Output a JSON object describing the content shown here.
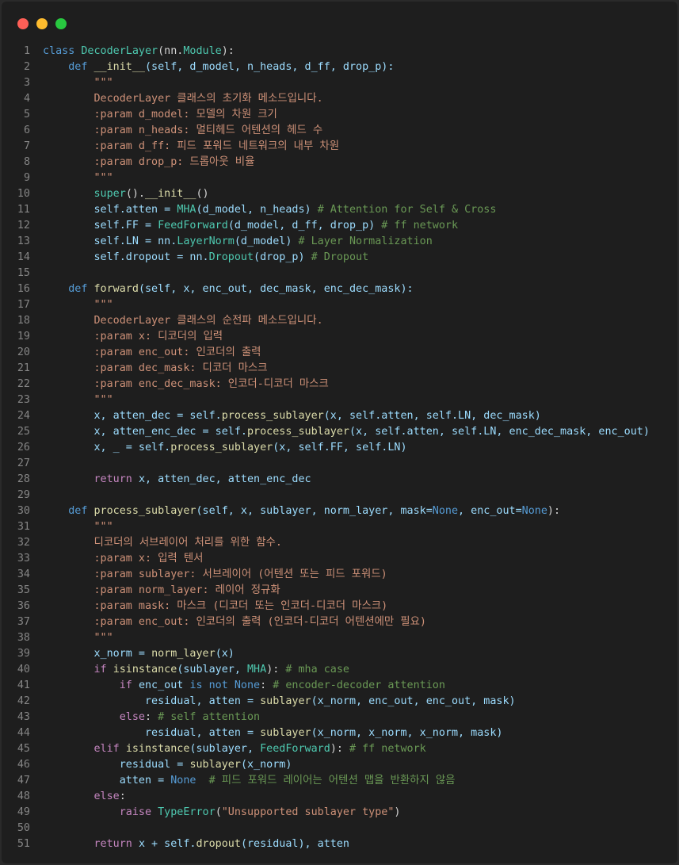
{
  "window": {
    "buttons": [
      "close",
      "minimize",
      "maximize"
    ],
    "colors": {
      "close": "#ff5f57",
      "minimize": "#febc2e",
      "maximize": "#28c840",
      "background": "#1e1e1e"
    }
  },
  "code": {
    "language": "python",
    "lines": [
      [
        {
          "t": "class ",
          "c": "kw"
        },
        {
          "t": "DecoderLayer",
          "c": "cls"
        },
        {
          "t": "(nn.",
          "c": ""
        },
        {
          "t": "Module",
          "c": "cls"
        },
        {
          "t": "):",
          "c": ""
        }
      ],
      [
        {
          "t": "    ",
          "c": ""
        },
        {
          "t": "def ",
          "c": "kw"
        },
        {
          "t": "__init__",
          "c": "fn"
        },
        {
          "t": "(self, d_model, n_heads, d_ff, drop_p):",
          "c": "var"
        }
      ],
      [
        {
          "t": "        \"\"\"",
          "c": "str"
        }
      ],
      [
        {
          "t": "        DecoderLayer 클래스의 초기화 메소드입니다.",
          "c": "str"
        }
      ],
      [
        {
          "t": "        :param d_model: 모델의 차원 크기",
          "c": "str"
        }
      ],
      [
        {
          "t": "        :param n_heads: 멀티헤드 어텐션의 헤드 수",
          "c": "str"
        }
      ],
      [
        {
          "t": "        :param d_ff: 피드 포워드 네트워크의 내부 차원",
          "c": "str"
        }
      ],
      [
        {
          "t": "        :param drop_p: 드롭아웃 비율",
          "c": "str"
        }
      ],
      [
        {
          "t": "        \"\"\"",
          "c": "str"
        }
      ],
      [
        {
          "t": "        ",
          "c": ""
        },
        {
          "t": "super",
          "c": "cls"
        },
        {
          "t": "().",
          "c": ""
        },
        {
          "t": "__init__",
          "c": "fn"
        },
        {
          "t": "()",
          "c": ""
        }
      ],
      [
        {
          "t": "        self.atten = ",
          "c": "var"
        },
        {
          "t": "MHA",
          "c": "cls"
        },
        {
          "t": "(d_model, n_heads) ",
          "c": "var"
        },
        {
          "t": "# Attention for Self & Cross",
          "c": "cm"
        }
      ],
      [
        {
          "t": "        self.FF = ",
          "c": "var"
        },
        {
          "t": "FeedForward",
          "c": "cls"
        },
        {
          "t": "(d_model, d_ff, drop_p) ",
          "c": "var"
        },
        {
          "t": "# ff network",
          "c": "cm"
        }
      ],
      [
        {
          "t": "        self.LN = nn.",
          "c": "var"
        },
        {
          "t": "LayerNorm",
          "c": "cls"
        },
        {
          "t": "(d_model) ",
          "c": "var"
        },
        {
          "t": "# Layer Normalization",
          "c": "cm"
        }
      ],
      [
        {
          "t": "        self.dropout = nn.",
          "c": "var"
        },
        {
          "t": "Dropout",
          "c": "cls"
        },
        {
          "t": "(drop_p) ",
          "c": "var"
        },
        {
          "t": "# Dropout",
          "c": "cm"
        }
      ],
      [
        {
          "t": "",
          "c": ""
        }
      ],
      [
        {
          "t": "    ",
          "c": ""
        },
        {
          "t": "def ",
          "c": "kw"
        },
        {
          "t": "forward",
          "c": "fn"
        },
        {
          "t": "(self, x, enc_out, dec_mask, enc_dec_mask):",
          "c": "var"
        }
      ],
      [
        {
          "t": "        \"\"\"",
          "c": "str"
        }
      ],
      [
        {
          "t": "        DecoderLayer 클래스의 순전파 메소드입니다.",
          "c": "str"
        }
      ],
      [
        {
          "t": "        :param x: 디코더의 입력",
          "c": "str"
        }
      ],
      [
        {
          "t": "        :param enc_out: 인코더의 출력",
          "c": "str"
        }
      ],
      [
        {
          "t": "        :param dec_mask: 디코더 마스크",
          "c": "str"
        }
      ],
      [
        {
          "t": "        :param enc_dec_mask: 인코더-디코더 마스크",
          "c": "str"
        }
      ],
      [
        {
          "t": "        \"\"\"",
          "c": "str"
        }
      ],
      [
        {
          "t": "        x, atten_dec = self.",
          "c": "var"
        },
        {
          "t": "process_sublayer",
          "c": "fn"
        },
        {
          "t": "(x, self.atten, self.LN, dec_mask)",
          "c": "var"
        }
      ],
      [
        {
          "t": "        x, atten_enc_dec = self.",
          "c": "var"
        },
        {
          "t": "process_sublayer",
          "c": "fn"
        },
        {
          "t": "(x, self.atten, self.LN, enc_dec_mask, enc_out)",
          "c": "var"
        }
      ],
      [
        {
          "t": "        x, _ = self.",
          "c": "var"
        },
        {
          "t": "process_sublayer",
          "c": "fn"
        },
        {
          "t": "(x, self.FF, self.LN)",
          "c": "var"
        }
      ],
      [
        {
          "t": "",
          "c": ""
        }
      ],
      [
        {
          "t": "        ",
          "c": ""
        },
        {
          "t": "return ",
          "c": "kw2"
        },
        {
          "t": "x, atten_dec, atten_enc_dec",
          "c": "var"
        }
      ],
      [
        {
          "t": "",
          "c": ""
        }
      ],
      [
        {
          "t": "    ",
          "c": ""
        },
        {
          "t": "def ",
          "c": "kw"
        },
        {
          "t": "process_sublayer",
          "c": "fn"
        },
        {
          "t": "(self, x, sublayer, norm_layer, mask=",
          "c": "var"
        },
        {
          "t": "None",
          "c": "kw"
        },
        {
          "t": ", enc_out=",
          "c": "var"
        },
        {
          "t": "None",
          "c": "kw"
        },
        {
          "t": "):",
          "c": ""
        }
      ],
      [
        {
          "t": "        \"\"\"",
          "c": "str"
        }
      ],
      [
        {
          "t": "        디코더의 서브레이어 처리를 위한 함수.",
          "c": "str"
        }
      ],
      [
        {
          "t": "        :param x: 입력 텐서",
          "c": "str"
        }
      ],
      [
        {
          "t": "        :param sublayer: 서브레이어 (어텐션 또는 피드 포워드)",
          "c": "str"
        }
      ],
      [
        {
          "t": "        :param norm_layer: 레이어 정규화",
          "c": "str"
        }
      ],
      [
        {
          "t": "        :param mask: 마스크 (디코더 또는 인코더-디코더 마스크)",
          "c": "str"
        }
      ],
      [
        {
          "t": "        :param enc_out: 인코더의 출력 (인코더-디코더 어텐션에만 필요)",
          "c": "str"
        }
      ],
      [
        {
          "t": "        \"\"\"",
          "c": "str"
        }
      ],
      [
        {
          "t": "        x_norm = ",
          "c": "var"
        },
        {
          "t": "norm_layer",
          "c": "fn"
        },
        {
          "t": "(x)",
          "c": "var"
        }
      ],
      [
        {
          "t": "        ",
          "c": ""
        },
        {
          "t": "if ",
          "c": "kw2"
        },
        {
          "t": "isinstance",
          "c": "fn"
        },
        {
          "t": "(sublayer, ",
          "c": "var"
        },
        {
          "t": "MHA",
          "c": "cls"
        },
        {
          "t": "): ",
          "c": ""
        },
        {
          "t": "# mha case",
          "c": "cm"
        }
      ],
      [
        {
          "t": "            ",
          "c": ""
        },
        {
          "t": "if ",
          "c": "kw2"
        },
        {
          "t": "enc_out ",
          "c": "var"
        },
        {
          "t": "is not None",
          "c": "kw"
        },
        {
          "t": ": ",
          "c": ""
        },
        {
          "t": "# encoder-decoder attention",
          "c": "cm"
        }
      ],
      [
        {
          "t": "                residual, atten = ",
          "c": "var"
        },
        {
          "t": "sublayer",
          "c": "fn"
        },
        {
          "t": "(x_norm, enc_out, enc_out, mask)",
          "c": "var"
        }
      ],
      [
        {
          "t": "            ",
          "c": ""
        },
        {
          "t": "else",
          "c": "kw2"
        },
        {
          "t": ": ",
          "c": ""
        },
        {
          "t": "# self attention",
          "c": "cm"
        }
      ],
      [
        {
          "t": "                residual, atten = ",
          "c": "var"
        },
        {
          "t": "sublayer",
          "c": "fn"
        },
        {
          "t": "(x_norm, x_norm, x_norm, mask)",
          "c": "var"
        }
      ],
      [
        {
          "t": "        ",
          "c": ""
        },
        {
          "t": "elif ",
          "c": "kw2"
        },
        {
          "t": "isinstance",
          "c": "fn"
        },
        {
          "t": "(sublayer, ",
          "c": "var"
        },
        {
          "t": "FeedForward",
          "c": "cls"
        },
        {
          "t": "): ",
          "c": ""
        },
        {
          "t": "# ff network",
          "c": "cm"
        }
      ],
      [
        {
          "t": "            residual = ",
          "c": "var"
        },
        {
          "t": "sublayer",
          "c": "fn"
        },
        {
          "t": "(x_norm)",
          "c": "var"
        }
      ],
      [
        {
          "t": "            atten = ",
          "c": "var"
        },
        {
          "t": "None",
          "c": "kw"
        },
        {
          "t": "  ",
          "c": ""
        },
        {
          "t": "# 피드 포워드 레이어는 어텐션 맵을 반환하지 않음",
          "c": "cm"
        }
      ],
      [
        {
          "t": "        ",
          "c": ""
        },
        {
          "t": "else",
          "c": "kw2"
        },
        {
          "t": ":",
          "c": ""
        }
      ],
      [
        {
          "t": "            ",
          "c": ""
        },
        {
          "t": "raise ",
          "c": "kw2"
        },
        {
          "t": "TypeError",
          "c": "cls"
        },
        {
          "t": "(",
          "c": ""
        },
        {
          "t": "\"Unsupported sublayer type\"",
          "c": "str"
        },
        {
          "t": ")",
          "c": ""
        }
      ],
      [
        {
          "t": "",
          "c": ""
        }
      ],
      [
        {
          "t": "        ",
          "c": ""
        },
        {
          "t": "return ",
          "c": "kw2"
        },
        {
          "t": "x + self.",
          "c": "var"
        },
        {
          "t": "dropout",
          "c": "fn"
        },
        {
          "t": "(residual), atten",
          "c": "var"
        }
      ]
    ]
  }
}
